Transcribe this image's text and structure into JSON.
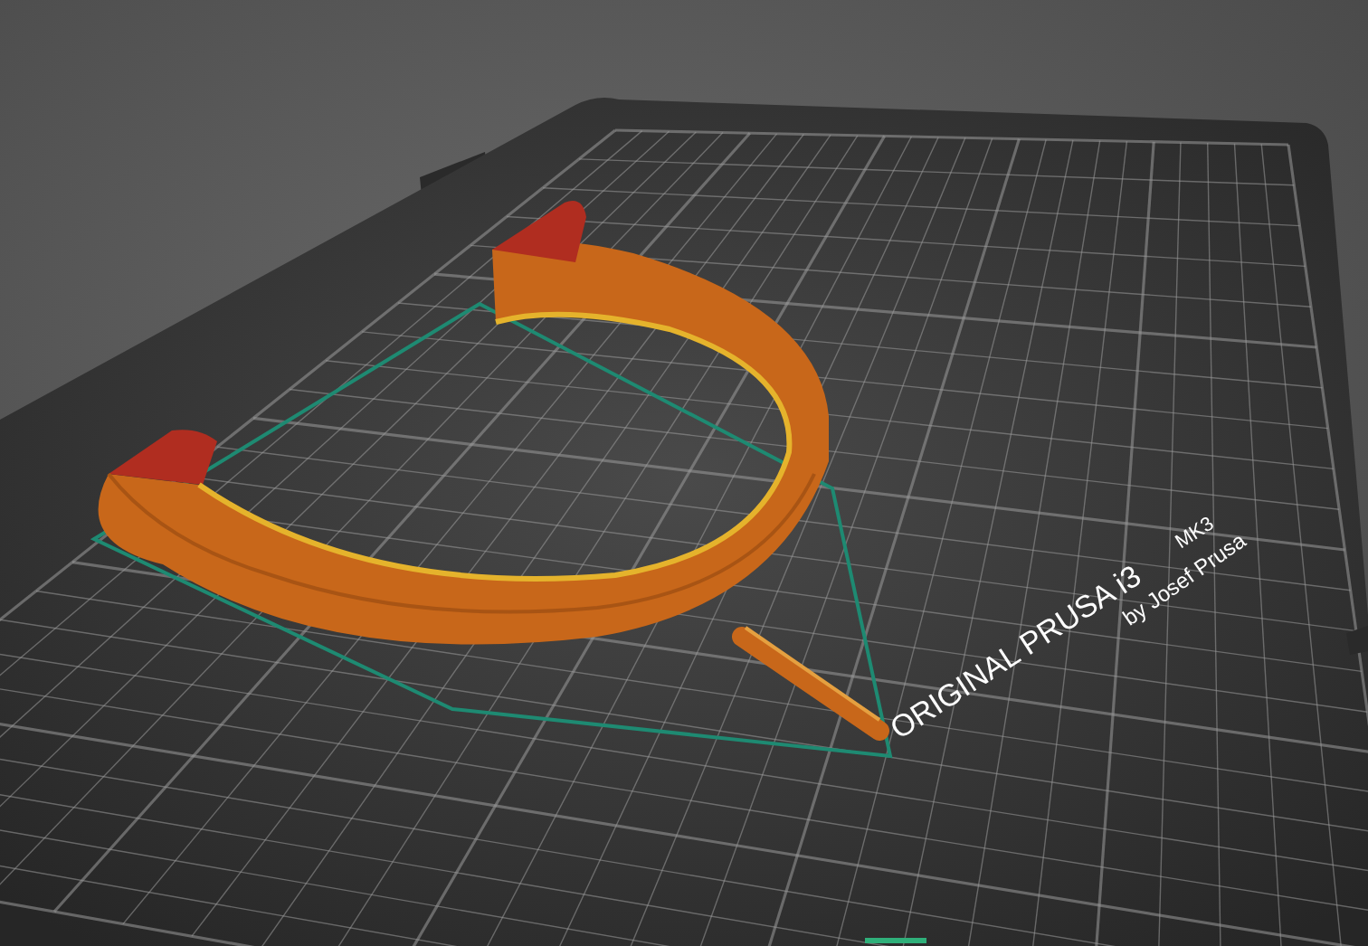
{
  "viewport": {
    "bed_label": "ORIGINAL PRUSA i3",
    "bed_model": "MK3",
    "bed_maker": "by Josef Prusa"
  }
}
